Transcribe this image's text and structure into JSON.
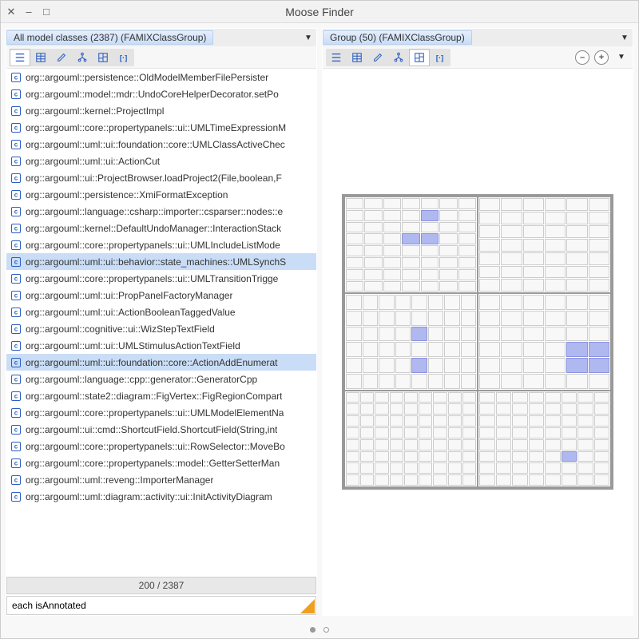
{
  "window": {
    "title": "Moose Finder"
  },
  "left": {
    "title": "All model classes (2387) (FAMIXClassGroup)",
    "status": "200 / 2387",
    "filter": "each isAnnotated",
    "items": [
      {
        "label": "org::argouml::persistence::OldModelMemberFilePersister",
        "selected": false
      },
      {
        "label": "org::argouml::model::mdr::UndoCoreHelperDecorator.setPo",
        "selected": false
      },
      {
        "label": "org::argouml::kernel::ProjectImpl",
        "selected": false
      },
      {
        "label": "org::argouml::core::propertypanels::ui::UMLTimeExpressionM",
        "selected": false
      },
      {
        "label": "org::argouml::uml::ui::foundation::core::UMLClassActiveChec",
        "selected": false
      },
      {
        "label": "org::argouml::uml::ui::ActionCut",
        "selected": false
      },
      {
        "label": "org::argouml::ui::ProjectBrowser.loadProject2(File,boolean,F",
        "selected": false
      },
      {
        "label": "org::argouml::persistence::XmiFormatException",
        "selected": false
      },
      {
        "label": "org::argouml::language::csharp::importer::csparser::nodes::e",
        "selected": false
      },
      {
        "label": "org::argouml::kernel::DefaultUndoManager::InteractionStack",
        "selected": false
      },
      {
        "label": "org::argouml::core::propertypanels::ui::UMLIncludeListMode",
        "selected": false
      },
      {
        "label": "org::argouml::uml::ui::behavior::state_machines::UMLSynchS",
        "selected": true
      },
      {
        "label": "org::argouml::core::propertypanels::ui::UMLTransitionTrigge",
        "selected": false
      },
      {
        "label": "org::argouml::uml::ui::PropPanelFactoryManager",
        "selected": false
      },
      {
        "label": "org::argouml::uml::ui::ActionBooleanTaggedValue",
        "selected": false
      },
      {
        "label": "org::argouml::cognitive::ui::WizStepTextField",
        "selected": false
      },
      {
        "label": "org::argouml::uml::ui::UMLStimulusActionTextField",
        "selected": false
      },
      {
        "label": "org::argouml::uml::ui::foundation::core::ActionAddEnumerat",
        "selected": true
      },
      {
        "label": "org::argouml::language::cpp::generator::GeneratorCpp",
        "selected": false
      },
      {
        "label": "org::argouml::state2::diagram::FigVertex::FigRegionCompart",
        "selected": false
      },
      {
        "label": "org::argouml::core::propertypanels::ui::UMLModelElementNa",
        "selected": false
      },
      {
        "label": "org::argouml::ui::cmd::ShortcutField.ShortcutField(String,int",
        "selected": false
      },
      {
        "label": "org::argouml::core::propertypanels::ui::RowSelector::MoveBo",
        "selected": false
      },
      {
        "label": "org::argouml::core::propertypanels::model::GetterSetterMan",
        "selected": false
      },
      {
        "label": "org::argouml::uml::reveng::ImporterManager",
        "selected": false
      },
      {
        "label": "org::argouml::uml::diagram::activity::ui::InitActivityDiagram",
        "selected": false
      }
    ]
  },
  "right": {
    "title": "Group (50) (FAMIXClassGroup)"
  },
  "icons": {
    "close": "✕",
    "minimize": "–",
    "maximize": "□",
    "dropdown": "▼",
    "minus": "–",
    "plus": "+"
  }
}
